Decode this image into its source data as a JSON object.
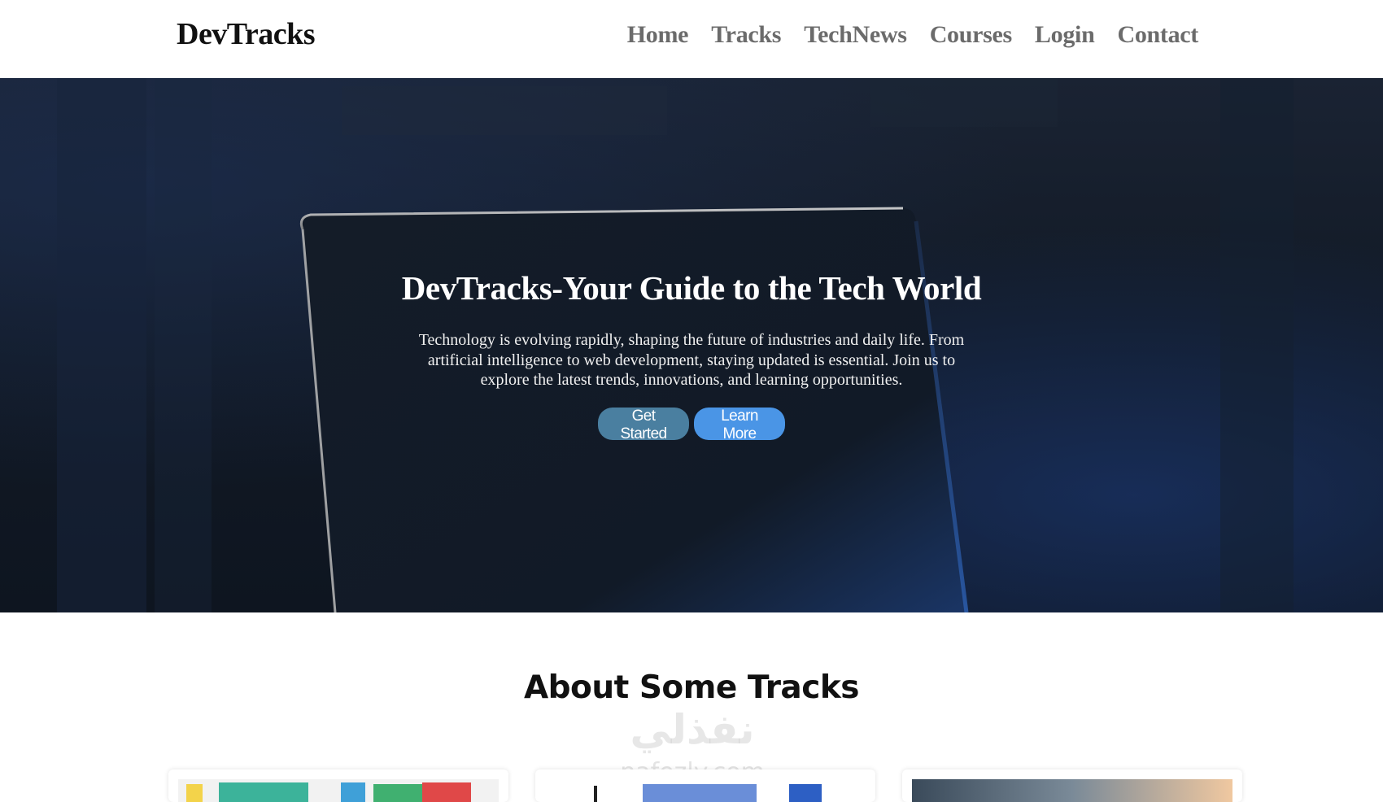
{
  "navbar": {
    "brand": "DevTracks",
    "links": [
      {
        "label": "Home"
      },
      {
        "label": "Tracks"
      },
      {
        "label": "TechNews"
      },
      {
        "label": "Courses"
      },
      {
        "label": "Login"
      },
      {
        "label": "Contact"
      }
    ]
  },
  "hero": {
    "title": "DevTracks-Your Guide to the Tech World",
    "description": "Technology is evolving rapidly, shaping the future of industries and daily life. From artificial intelligence to web development, staying updated is essential. Join us to explore the latest trends, innovations, and learning opportunities.",
    "buttons": {
      "get_started": "Get Started",
      "learn_more": "Learn More"
    }
  },
  "about": {
    "title": "About Some Tracks"
  },
  "watermark": {
    "arabic": "نفذلي",
    "url": "nafezly.com"
  },
  "colors": {
    "get_started_bg": "#4a7fa0",
    "learn_more_bg": "#4a95e6",
    "hero_bg": "#121a26",
    "nav_link": "#6b6b6b"
  }
}
